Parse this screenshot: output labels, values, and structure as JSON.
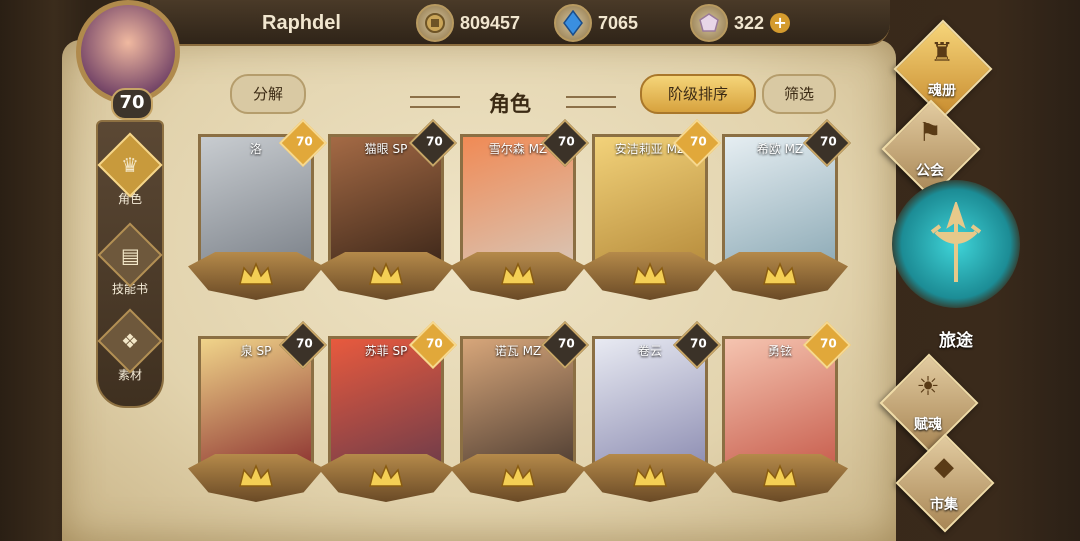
{
  "player": {
    "name": "Raphdel",
    "level": "70"
  },
  "resources": {
    "gold": "809457",
    "crystal": "7065",
    "gem": "322",
    "gem_plus": "+"
  },
  "side_menu": [
    {
      "label": "角色",
      "icon": "character-icon",
      "active": true
    },
    {
      "label": "技能书",
      "icon": "skillbook-icon",
      "active": false
    },
    {
      "label": "素材",
      "icon": "material-icon",
      "active": false
    }
  ],
  "toolbar": {
    "decompose": "分解",
    "title": "角色",
    "sort": "阶级排序",
    "filter": "筛选"
  },
  "cards": [
    {
      "name": "洛",
      "level": "70",
      "gold": true,
      "colors": [
        "#c8ccd0",
        "#7a8088"
      ]
    },
    {
      "name": "猫眼 SP",
      "level": "70",
      "gold": false,
      "colors": [
        "#a46a45",
        "#3a2518"
      ]
    },
    {
      "name": "雪尔森 MZ",
      "level": "70",
      "gold": false,
      "colors": [
        "#f08a55",
        "#d8c7b8"
      ]
    },
    {
      "name": "安洁莉亚 MZ",
      "level": "70",
      "gold": true,
      "colors": [
        "#f2d27a",
        "#b58a3a"
      ]
    },
    {
      "name": "希欧 MZ",
      "level": "70",
      "gold": false,
      "colors": [
        "#e6eef2",
        "#8aa8b4"
      ]
    },
    {
      "name": "泉 SP",
      "level": "70",
      "gold": false,
      "colors": [
        "#f0d48a",
        "#8a2e2e"
      ]
    },
    {
      "name": "苏菲 SP",
      "level": "70",
      "gold": true,
      "colors": [
        "#e85a3e",
        "#6a3b4a"
      ]
    },
    {
      "name": "诺瓦 MZ",
      "level": "70",
      "gold": false,
      "colors": [
        "#d7a67a",
        "#4a3a30"
      ]
    },
    {
      "name": "卷云",
      "level": "70",
      "gold": false,
      "colors": [
        "#e8eaf2",
        "#8a8ab0"
      ]
    },
    {
      "name": "勇铉",
      "level": "70",
      "gold": true,
      "colors": [
        "#f5c4b0",
        "#c65a4a"
      ]
    }
  ],
  "right_menu": [
    {
      "label": "魂册",
      "icon": "soulbook-icon",
      "active": true
    },
    {
      "label": "公会",
      "icon": "guild-icon",
      "active": false
    },
    {
      "label": "赋魂",
      "icon": "ensoul-icon",
      "active": false
    },
    {
      "label": "市集",
      "icon": "market-icon",
      "active": false
    }
  ],
  "journey": {
    "label": "旅途"
  }
}
